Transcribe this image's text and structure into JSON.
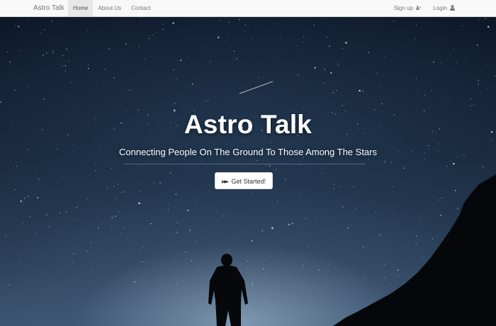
{
  "navbar": {
    "brand": "Astro Talk",
    "links": [
      {
        "label": "Home",
        "active": true
      },
      {
        "label": "About Us",
        "active": false
      },
      {
        "label": "Contact",
        "active": false
      }
    ],
    "right_links": [
      {
        "label": "Sign up",
        "icon": "user-plus-icon"
      },
      {
        "label": "Login",
        "icon": "user-icon"
      }
    ]
  },
  "hero": {
    "title": "Astro Talk",
    "subtitle": "Connecting People On The Ground To Those Among The Stars",
    "cta_label": "Get Started!",
    "cta_icon": "rocket-icon"
  },
  "colors": {
    "navbar_bg": "#f8f8f8",
    "active_tab_bg": "#e7e7e7",
    "text_muted": "#777777",
    "hero_text": "#ffffff"
  }
}
